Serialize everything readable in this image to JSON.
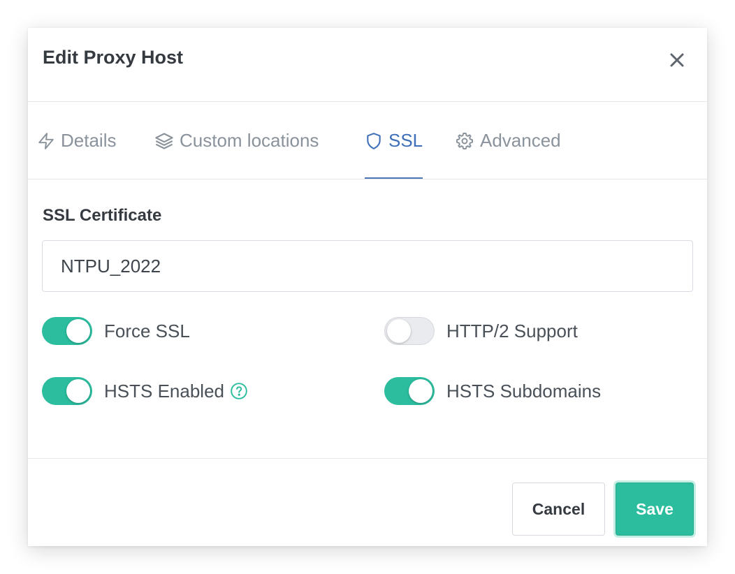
{
  "modal": {
    "title": "Edit Proxy Host",
    "close_icon": "close-icon"
  },
  "tabs": [
    {
      "label": "Details",
      "icon": "lightning-icon",
      "active": false
    },
    {
      "label": "Custom locations",
      "icon": "layers-icon",
      "active": false
    },
    {
      "label": "SSL",
      "icon": "shield-icon",
      "active": true
    },
    {
      "label": "Advanced",
      "icon": "gear-icon",
      "active": false
    }
  ],
  "ssl": {
    "certificate_label": "SSL Certificate",
    "certificate_value": "NTPU_2022"
  },
  "toggles": {
    "force_ssl": {
      "label": "Force SSL",
      "on": true
    },
    "http2": {
      "label": "HTTP/2 Support",
      "on": false
    },
    "hsts": {
      "label": "HSTS Enabled",
      "on": true
    },
    "hsts_subdomains": {
      "label": "HSTS Subdomains",
      "on": true
    }
  },
  "footer": {
    "cancel_label": "Cancel",
    "save_label": "Save"
  },
  "colors": {
    "accent": "#2bbd9e",
    "active_tab": "#3e6fb8",
    "inactive_tab": "#8a929b"
  }
}
